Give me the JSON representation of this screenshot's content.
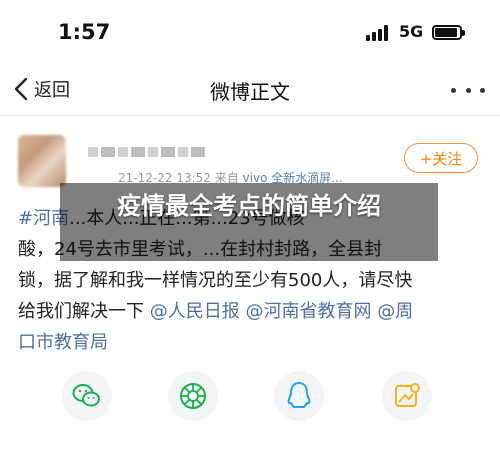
{
  "status_bar": {
    "time": "1:57",
    "network": "5G"
  },
  "nav": {
    "back_label": "返回",
    "title": "微博正文"
  },
  "post": {
    "timestamp": "21-12-22 13:52",
    "source_prefix": "来自",
    "source": "vivo 全新水滴屏...",
    "follow_label": "+关注",
    "body": {
      "tag": "#河南",
      "line1_rest": "...本人...正在...第...23号做核",
      "line2": "酸，24号去市里考试，...在封村封路，全县封",
      "line3": "锁，据了解和我一样情况的至少有500人，请尽快",
      "line4_pre": "给我们解决一下",
      "mention1": "@人民日报",
      "mention2": "@河南省教育网",
      "mention3": "@周",
      "line5": "口市教育局"
    }
  },
  "share": {
    "items": [
      "wechat-icon",
      "moments-icon",
      "qq-icon",
      "qzone-icon"
    ]
  },
  "overlay": {
    "headline": "疫情最全考点的简单介绍"
  }
}
